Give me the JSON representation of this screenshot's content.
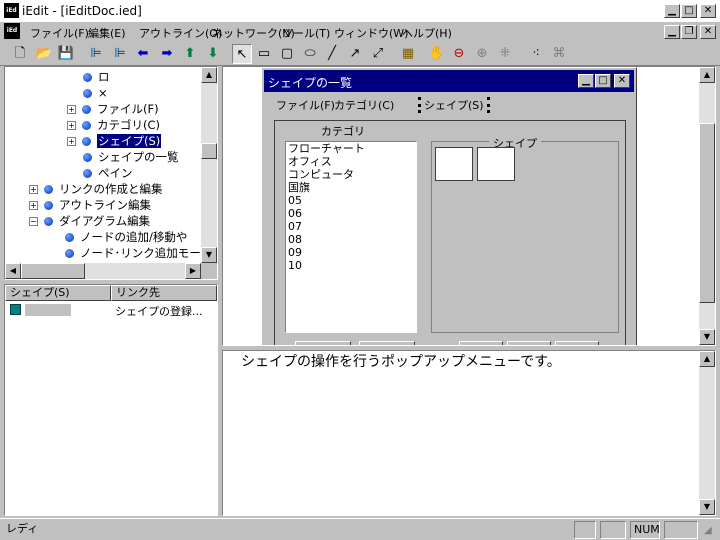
{
  "window": {
    "title": "iEdit - [iEditDoc.ied]",
    "app_icon_text": "iEd"
  },
  "menu": {
    "items": [
      "ファイル(F)",
      "編集(E)",
      "アウトライン(O)",
      "ネットワーク(N)",
      "ツール(T)",
      "ウィンドウ(W)",
      "ヘルプ(H)"
    ]
  },
  "toolbar": {
    "icons": [
      "new-file-icon",
      "open-folder-icon",
      "save-icon",
      "outline-tree-icon",
      "outline-tree-alt-icon",
      "arrow-left-icon",
      "arrow-right-icon",
      "arrow-up-icon",
      "arrow-down-icon",
      "select-pointer-icon",
      "rectangle-icon",
      "rounded-rectangle-icon",
      "ellipse-icon",
      "line-icon",
      "arrow-line-icon",
      "double-arrow-line-icon",
      "map-icon",
      "hand-icon",
      "zoom-out-icon",
      "zoom-in-icon",
      "grid-icon",
      "layout-icon",
      "network-icon"
    ]
  },
  "tree": {
    "items": [
      {
        "label": "ロ",
        "expander": ""
      },
      {
        "label": "×",
        "expander": ""
      },
      {
        "label": "ファイル(F)",
        "expander": "+"
      },
      {
        "label": "カテゴリ(C)",
        "expander": "+"
      },
      {
        "label": "シェイプ(S)",
        "expander": "+",
        "selected": true
      },
      {
        "label": "シェイプの一覧",
        "expander": ""
      },
      {
        "label": "ペイン",
        "expander": ""
      },
      {
        "label": "リンクの作成と編集",
        "expander": "+"
      },
      {
        "label": "アウトライン編集",
        "expander": "+"
      },
      {
        "label": "ダイアグラム編集",
        "expander": "−"
      },
      {
        "label": "ノードの追加/移動や",
        "expander": ""
      },
      {
        "label": "ノード･リンク追加モー",
        "expander": ""
      }
    ]
  },
  "link_list": {
    "headers": [
      "シェイプ(S)",
      "リンク先"
    ],
    "rows": [
      {
        "shape": "",
        "target": "シェイプの登録..."
      }
    ]
  },
  "dialog": {
    "title": "シェイプの一覧",
    "menu": [
      "ファイル(F)",
      "カテゴリ(C)",
      "シェイプ(S)"
    ],
    "category_label": "カテゴリ",
    "shape_label": "シェイプ",
    "categories": [
      "フローチャート",
      "オフィス",
      "コンピュータ",
      "国旗",
      "05",
      "06",
      "07",
      "08",
      "09",
      "10"
    ]
  },
  "text_pane": {
    "content": "シェイプの操作を行うポップアップメニューです。"
  },
  "status": {
    "main": "レディ",
    "num": "NUM"
  }
}
